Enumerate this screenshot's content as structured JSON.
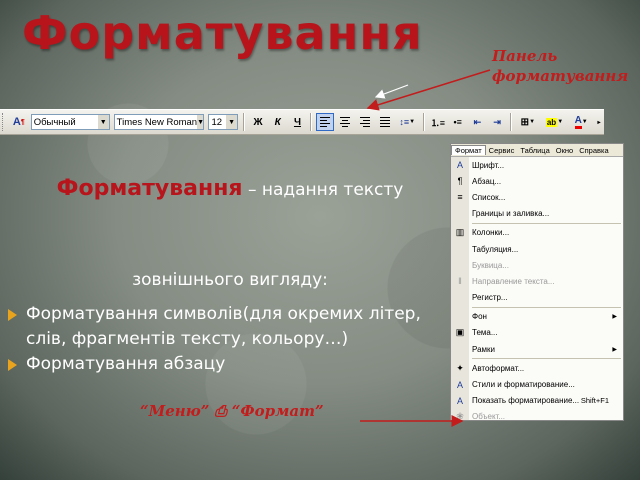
{
  "slide": {
    "title": "Форматування",
    "panel_label_line1": "Панель",
    "panel_label_line2": "форматування",
    "definition_term": "Форматування",
    "definition_rest": " – надання тексту",
    "definition_line2": "зовнішнього вигляду:",
    "bullets": [
      "Форматування символів(для окремих літер, слів, фрагментів тексту, кольору…)",
      "Форматування абзацу"
    ],
    "menu_note": "“Меню” ⎙ “Формат”"
  },
  "colors": {
    "title": "#b8141b",
    "label": "#c21c1c",
    "bullet": "#e9a31c",
    "accent_arrow": "#c21c1c"
  },
  "toolbar": {
    "style_value": "Обычный",
    "font_value": "Times New Roman",
    "size_value": "12",
    "bold": "Ж",
    "italic": "К",
    "underline": "Ч"
  },
  "format_menu": {
    "menubar": [
      "Формат",
      "Сервис",
      "Таблица",
      "Окно",
      "Справка"
    ],
    "items": [
      {
        "label": "Шрифт...",
        "icon": "A"
      },
      {
        "label": "Абзац...",
        "icon": "¶"
      },
      {
        "label": "Список...",
        "icon": "≡"
      },
      {
        "label": "Границы и заливка...",
        "icon": ""
      },
      {
        "label": "Колонки...",
        "icon": "▥"
      },
      {
        "label": "Табуляция...",
        "icon": ""
      },
      {
        "label": "Буквица...",
        "icon": "",
        "disabled": true
      },
      {
        "label": "Направление текста...",
        "icon": "‖",
        "disabled": true
      },
      {
        "label": "Регистр...",
        "icon": ""
      },
      {
        "label": "Фон",
        "icon": "",
        "submenu": true
      },
      {
        "label": "Тема...",
        "icon": "▣"
      },
      {
        "label": "Рамки",
        "icon": "",
        "submenu": true
      },
      {
        "label": "Автоформат...",
        "icon": "✦"
      },
      {
        "label": "Стили и форматирование...",
        "icon": "A"
      },
      {
        "label": "Показать форматирование...",
        "icon": "A",
        "shortcut": "Shift+F1"
      },
      {
        "label": "Объект...",
        "icon": "❀",
        "disabled": true
      }
    ]
  }
}
